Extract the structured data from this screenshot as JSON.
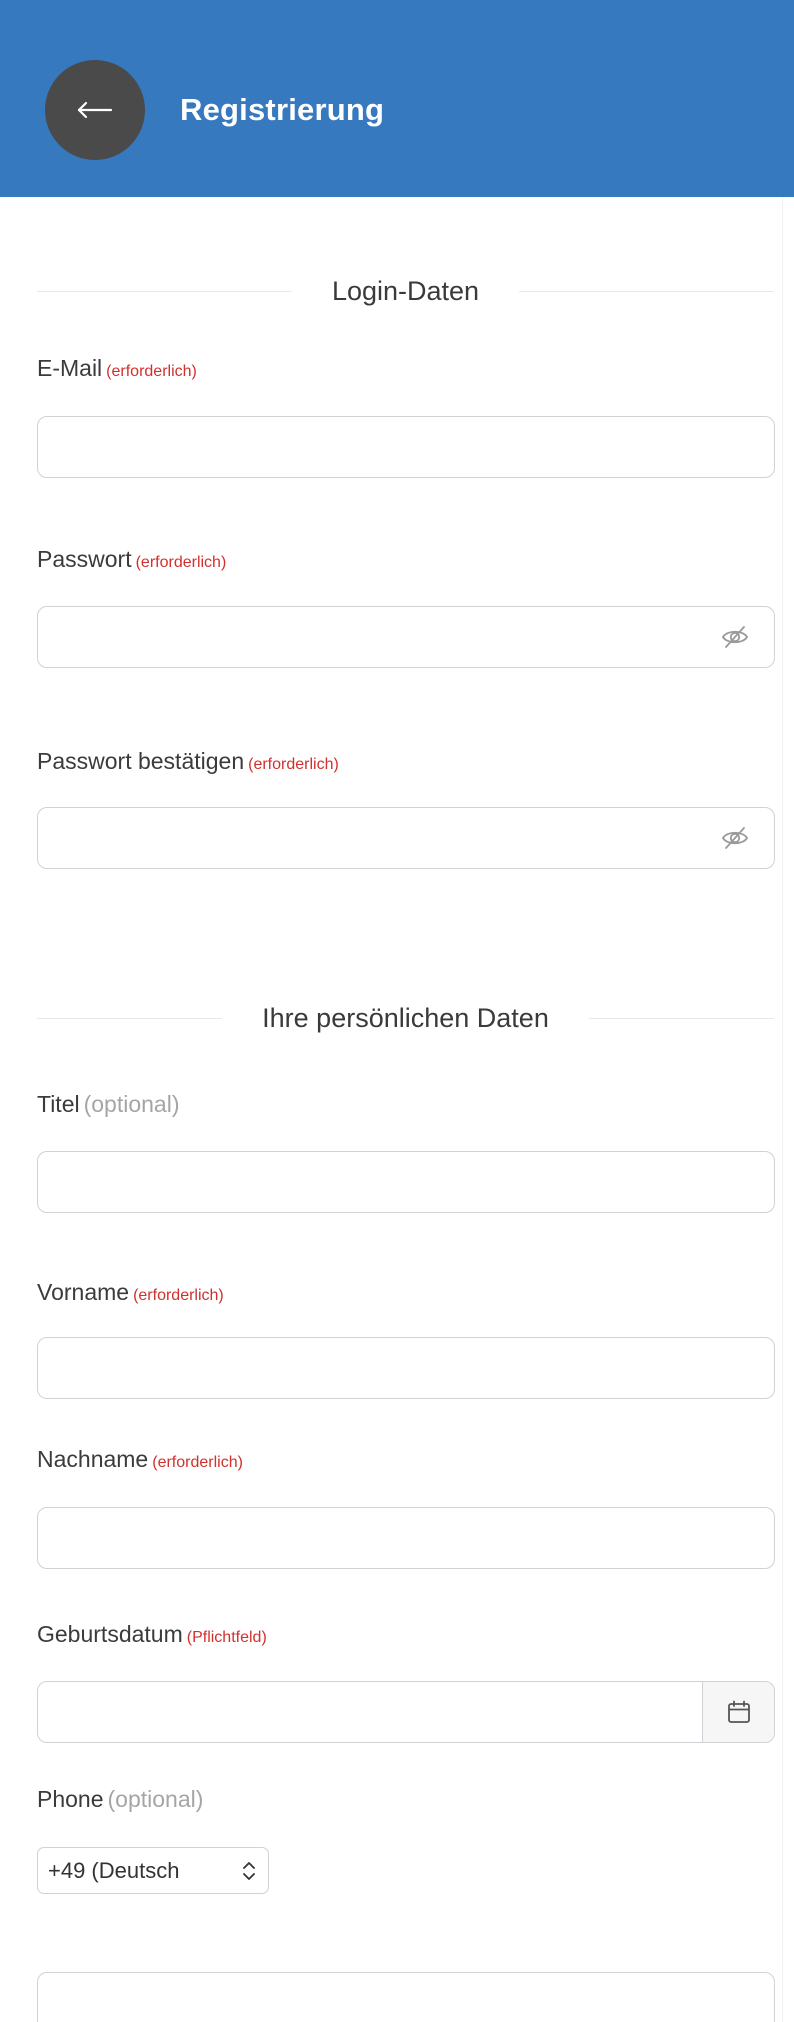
{
  "header": {
    "title": "Registrierung",
    "back_icon": "arrow-left-icon",
    "color": "#3679be"
  },
  "colors": {
    "required": "#d0312d",
    "optional": "#a5a5a5"
  },
  "sections": {
    "login": "Login-Daten",
    "personal": "Ihre persönlichen Daten"
  },
  "fields": {
    "email": {
      "label": "E-Mail",
      "tag": "(erforderlich)",
      "value": ""
    },
    "password": {
      "label": "Passwort",
      "tag": "(erforderlich)",
      "value": "",
      "icon": "eye-slash-icon"
    },
    "password_confirm": {
      "label": "Passwort bestätigen",
      "tag": "(erforderlich)",
      "value": "",
      "icon": "eye-slash-icon"
    },
    "title": {
      "label": "Titel",
      "tag": "(optional)",
      "value": ""
    },
    "firstname": {
      "label": "Vorname",
      "tag": "(erforderlich)",
      "value": ""
    },
    "lastname": {
      "label": "Nachname",
      "tag": "(erforderlich)",
      "value": ""
    },
    "birthdate": {
      "label": "Geburtsdatum",
      "tag": "(Pflichtfeld)",
      "value": "",
      "icon": "calendar-icon"
    },
    "phone": {
      "label": "Phone",
      "tag": "(optional)",
      "country": "+49 (Deutsch",
      "value": ""
    }
  }
}
